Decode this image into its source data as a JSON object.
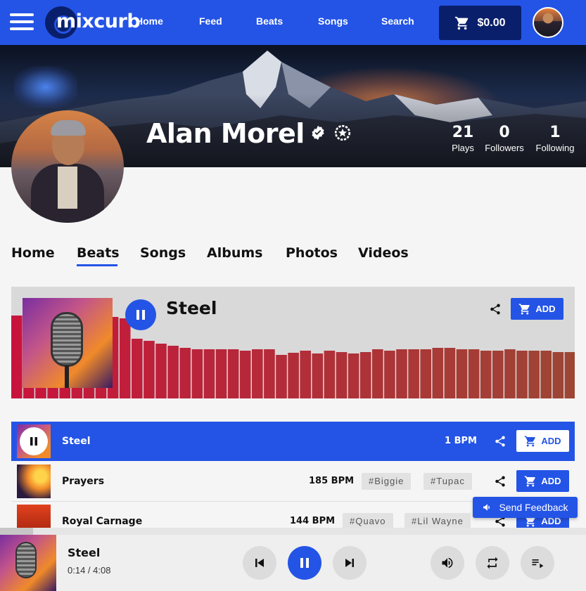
{
  "nav": {
    "logo_text": "mixcurb",
    "links": [
      "Home",
      "Feed",
      "Beats",
      "Songs",
      "Search"
    ],
    "cart_total": "$0.00"
  },
  "profile": {
    "name": "Alan Morel",
    "stats": [
      {
        "value": "21",
        "label": "Plays"
      },
      {
        "value": "0",
        "label": "Followers"
      },
      {
        "value": "1",
        "label": "Following"
      }
    ]
  },
  "tabs": [
    "Home",
    "Beats",
    "Songs",
    "Albums",
    "Photos",
    "Videos"
  ],
  "active_tab": "Beats",
  "featured": {
    "title": "Steel",
    "add_label": "ADD"
  },
  "tracks": [
    {
      "title": "Steel",
      "bpm": "1 BPM",
      "tags": [],
      "add_label": "ADD",
      "active": true
    },
    {
      "title": "Prayers",
      "bpm": "185 BPM",
      "tags": [
        "#Biggie",
        "#Tupac"
      ],
      "add_label": "ADD",
      "active": false
    },
    {
      "title": "Royal Carnage",
      "bpm": "144 BPM",
      "tags": [
        "#Quavo",
        "#Lil Wayne"
      ],
      "add_label": "ADD",
      "active": false
    }
  ],
  "feedback_label": "Send Feedback",
  "player": {
    "title": "Steel",
    "time": "0:14 / 4:08",
    "progress_fraction": 0.056
  },
  "colors": {
    "accent": "#2454e6",
    "dark_accent": "#0a1f6b"
  },
  "icons": [
    "menu-icon",
    "cart-icon",
    "verified-icon",
    "star-badge-icon",
    "pause-icon",
    "share-icon",
    "previous-icon",
    "next-icon",
    "volume-icon",
    "repeat-icon",
    "queue-icon",
    "megaphone-icon"
  ]
}
